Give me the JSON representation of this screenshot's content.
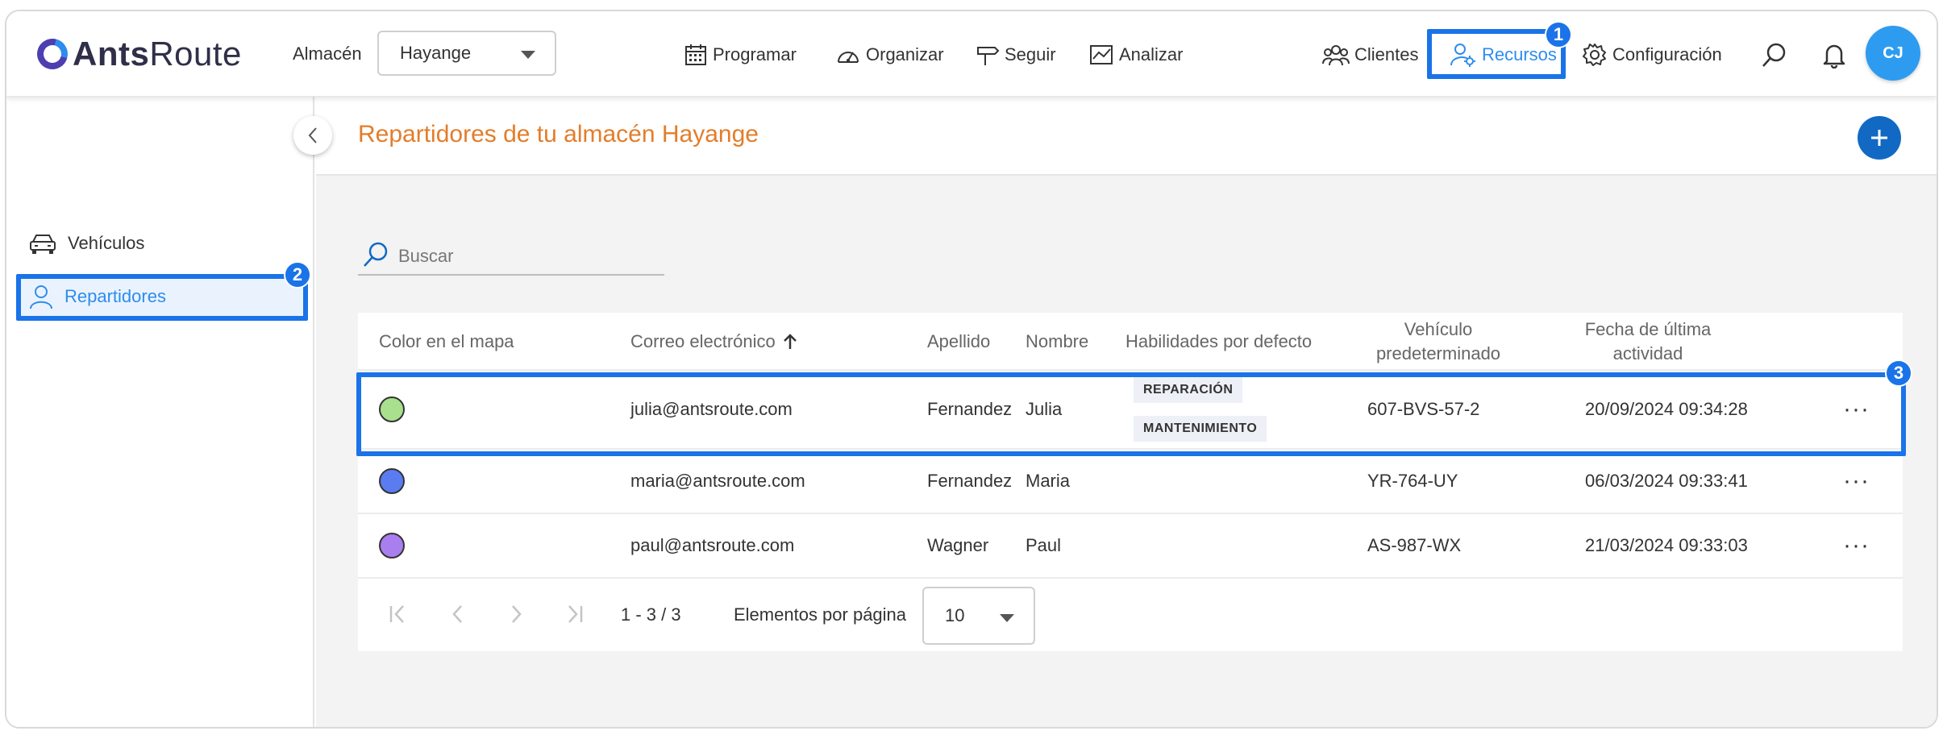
{
  "app": {
    "logo_bold": "Ants",
    "logo_light": "Route"
  },
  "warehouse": {
    "label": "Almacén",
    "selected": "Hayange"
  },
  "nav": {
    "programar": "Programar",
    "organizar": "Organizar",
    "seguir": "Seguir",
    "analizar": "Analizar",
    "clientes": "Clientes",
    "recursos": "Recursos",
    "configuracion": "Configuración"
  },
  "user": {
    "initials": "CJ"
  },
  "badges": {
    "one": "1",
    "two": "2",
    "three": "3"
  },
  "sidebar": {
    "items": [
      {
        "label": "Vehículos",
        "icon": "car-icon"
      },
      {
        "label": "Repartidores",
        "icon": "person-icon"
      }
    ]
  },
  "page": {
    "title": "Repartidores de tu almacén Hayange"
  },
  "search": {
    "placeholder": "Buscar"
  },
  "table": {
    "headers": {
      "color": "Color en el mapa",
      "email": "Correo electrónico",
      "apellido": "Apellido",
      "nombre": "Nombre",
      "habilidades": "Habilidades por defecto",
      "vehiculo_1": "Vehículo",
      "vehiculo_2": "predeterminado",
      "fecha_1": "Fecha de última",
      "fecha_2": "actividad"
    },
    "rows": [
      {
        "color": "#a8e08e",
        "email": "julia@antsroute.com",
        "apellido": "Fernandez",
        "nombre": "Julia",
        "skills": [
          "REPARACIÓN",
          "MANTENIMIENTO"
        ],
        "vehiculo": "607-BVS-57-2",
        "fecha": "20/09/2024 09:34:28"
      },
      {
        "color": "#5b7cf0",
        "email": "maria@antsroute.com",
        "apellido": "Fernandez",
        "nombre": "Maria",
        "skills": [],
        "vehiculo": "YR-764-UY",
        "fecha": "06/03/2024 09:33:41"
      },
      {
        "color": "#a97ff0",
        "email": "paul@antsroute.com",
        "apellido": "Wagner",
        "nombre": "Paul",
        "skills": [],
        "vehiculo": "AS-987-WX",
        "fecha": "21/03/2024 09:33:03"
      }
    ],
    "more_label": "···"
  },
  "pagination": {
    "range": "1 - 3 / 3",
    "per_page_label": "Elementos por página",
    "per_page_value": "10"
  },
  "colors": {
    "accent": "#2d8cf0",
    "title": "#e37d2a",
    "highlight": "#1a73e8",
    "add_button": "#1269c4"
  }
}
